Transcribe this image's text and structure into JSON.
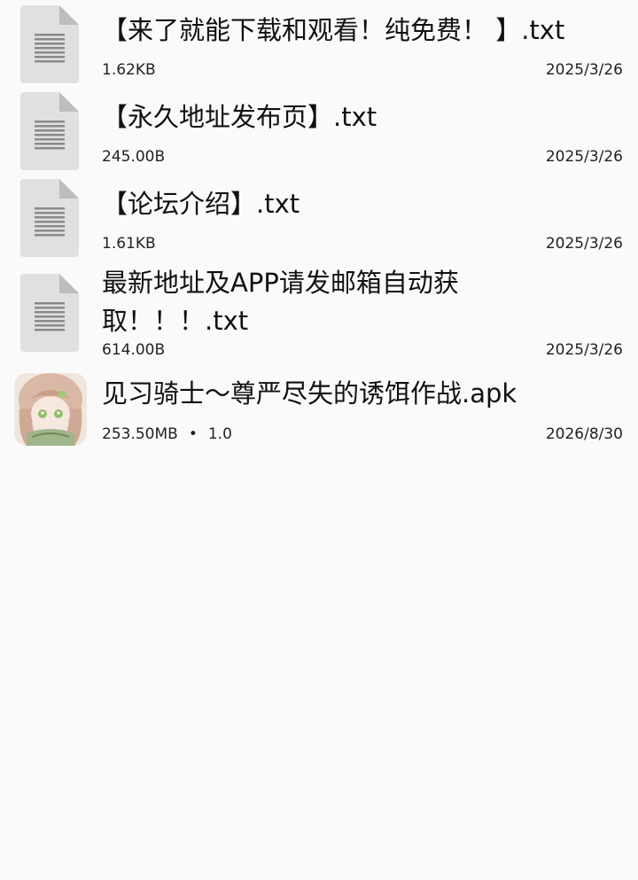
{
  "files": [
    {
      "name": "【来了就能下载和观看！纯免费！ 】.txt",
      "size": "1.62KB",
      "date": "2025/3/26",
      "icon": "text-file-icon"
    },
    {
      "name": "【永久地址发布页】.txt",
      "size": "245.00B",
      "date": "2025/3/26",
      "icon": "text-file-icon"
    },
    {
      "name": "【论坛介绍】.txt",
      "size": "1.61KB",
      "date": "2025/3/26",
      "icon": "text-file-icon"
    },
    {
      "name": "最新地址及APP请发邮箱自动获取！！！.txt",
      "size": "614.00B",
      "date": "2025/3/26",
      "icon": "text-file-icon"
    },
    {
      "name": "见习骑士～尊严尽失的诱饵作战.apk",
      "size": "253.50MB",
      "separator": "•",
      "version": "1.0",
      "date": "2026/8/30",
      "icon": "app-thumbnail-icon"
    }
  ],
  "colors": {
    "background": "#fafafa",
    "file_icon_body": "#e0e0e0",
    "file_icon_fold": "#bdbdbd",
    "file_icon_lines": "#8a8a8a"
  }
}
